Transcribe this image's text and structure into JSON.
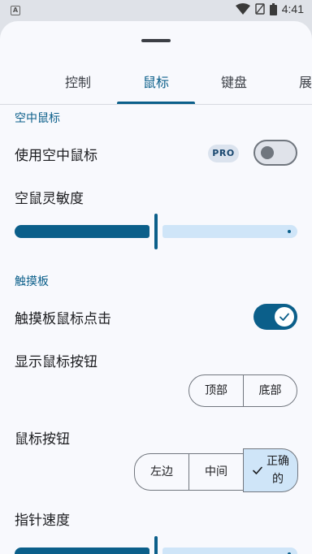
{
  "status_bar": {
    "left_icon": "A",
    "time": "4:41",
    "icons": [
      "wifi-icon",
      "sim-icon",
      "battery-icon"
    ]
  },
  "tabs": [
    {
      "label": "控制",
      "active": false
    },
    {
      "label": "鼠标",
      "active": true
    },
    {
      "label": "键盘",
      "active": false
    },
    {
      "label": "展",
      "active": false
    }
  ],
  "sections": {
    "air_mouse": {
      "title": "空中鼠标",
      "use_air_mouse_label": "使用空中鼠标",
      "pro_badge": "PRO",
      "use_air_mouse_on": false,
      "sensitivity_label": "空鼠灵敏度",
      "sensitivity_value": 0.5
    },
    "touchpad": {
      "title": "触摸板",
      "click_label": "触摸板鼠标点击",
      "click_on": true,
      "show_buttons_label": "显示鼠标按钮",
      "show_buttons_options": [
        "顶部",
        "底部"
      ],
      "mouse_button_label": "鼠标按钮",
      "mouse_button_options": [
        "左边",
        "中间",
        "正确\n的"
      ],
      "mouse_button_selected": 2,
      "pointer_speed_label": "指针速度",
      "pointer_speed_value": 0.5
    }
  },
  "colors": {
    "accent": "#0b5f8a",
    "track_inactive": "#cfe5f8",
    "sheet_bg": "#f8f9fd"
  }
}
